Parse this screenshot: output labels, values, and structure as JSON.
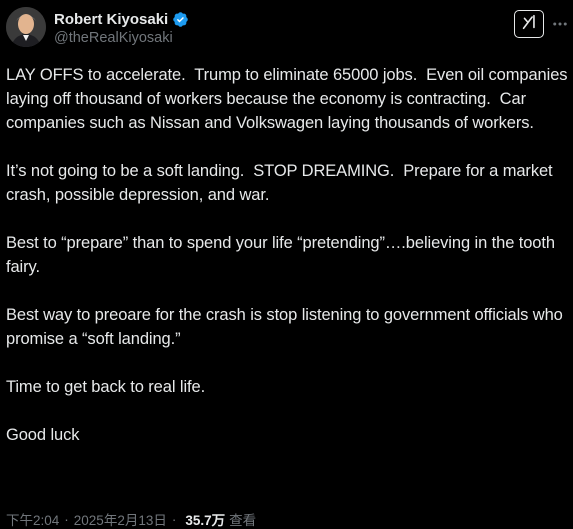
{
  "author": {
    "display_name": "Robert Kiyosaki",
    "handle": "@theRealKiyosaki",
    "verified": true
  },
  "icons": {
    "verified": "verified-badge-icon",
    "grok": "grok-icon",
    "more": "more-icon"
  },
  "colors": {
    "background": "#000000",
    "text_primary": "#e7e9ea",
    "text_secondary": "#71767b",
    "verified_blue": "#1d9bf0"
  },
  "tweet": {
    "paragraphs": [
      "LAY OFFS to accelerate.  Trump to eliminate 65000 jobs.  Even oil companies laying off thousand of workers because the economy is contracting.  Car companies such as Nissan and Volkswagen laying thousands of workers.",
      "It’s not going to be a soft landing.  STOP DREAMING.  Prepare for a market crash, possible depression, and war.",
      "Best to “prepare” than to spend your life “pretending”….believing in the tooth fairy.",
      "Best way to preoare for the crash is stop listening to government officials who promise a “soft landing.”",
      "Time to get back to real life.",
      "Good luck"
    ]
  },
  "meta": {
    "time": "下午2:04",
    "separator": "·",
    "date": "2025年2月13日",
    "views_count": "35.7万",
    "views_label": "查看"
  }
}
